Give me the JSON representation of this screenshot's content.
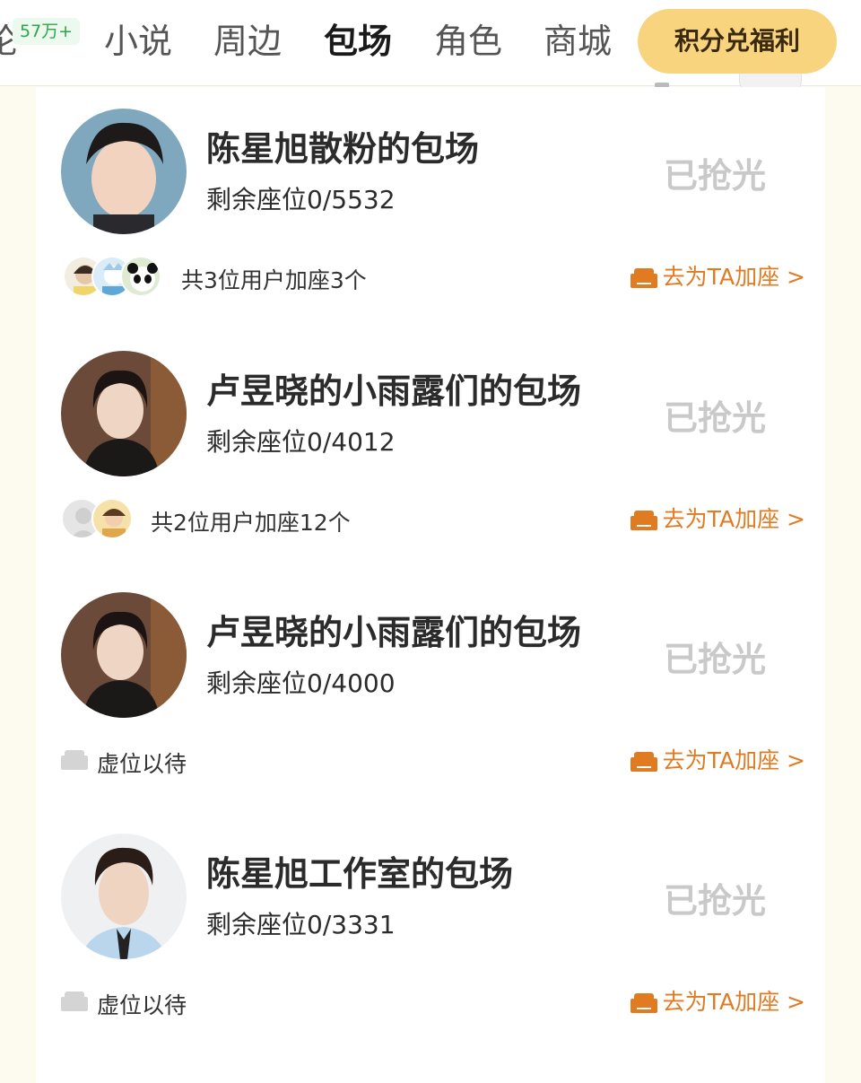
{
  "header": {
    "partial_tab": "论",
    "badge": "57万+",
    "tabs": [
      "小说",
      "周边",
      "包场",
      "角色",
      "商城"
    ],
    "active_tab": "包场",
    "redeem_label": "积分兑福利"
  },
  "cards": [
    {
      "title": "陈星旭散粉的包场",
      "seats": "剩余座位0/5532",
      "status": "已抢光",
      "footer_text": "共3位用户加座3个",
      "has_supporters": true,
      "action": "去为TA加座 >"
    },
    {
      "title": "卢昱晓的小雨露们的包场",
      "seats": "剩余座位0/4012",
      "status": "已抢光",
      "footer_text": "共2位用户加座12个",
      "has_supporters": true,
      "action": "去为TA加座 >"
    },
    {
      "title": "卢昱晓的小雨露们的包场",
      "seats": "剩余座位0/4000",
      "status": "已抢光",
      "footer_text": "虚位以待",
      "has_supporters": false,
      "action": "去为TA加座 >"
    },
    {
      "title": "陈星旭工作室的包场",
      "seats": "剩余座位0/3331",
      "status": "已抢光",
      "footer_text": "虚位以待",
      "has_supporters": false,
      "action": "去为TA加座 >"
    }
  ],
  "colors": {
    "accent": "#e07b22",
    "redeem_bg": "#f8d47e",
    "sold_out": "#c9c9c9",
    "badge_green": "#2fa54a",
    "page_bg": "#fdfaf0"
  },
  "icons": [
    "sofa-icon",
    "empty-seat-icon"
  ]
}
